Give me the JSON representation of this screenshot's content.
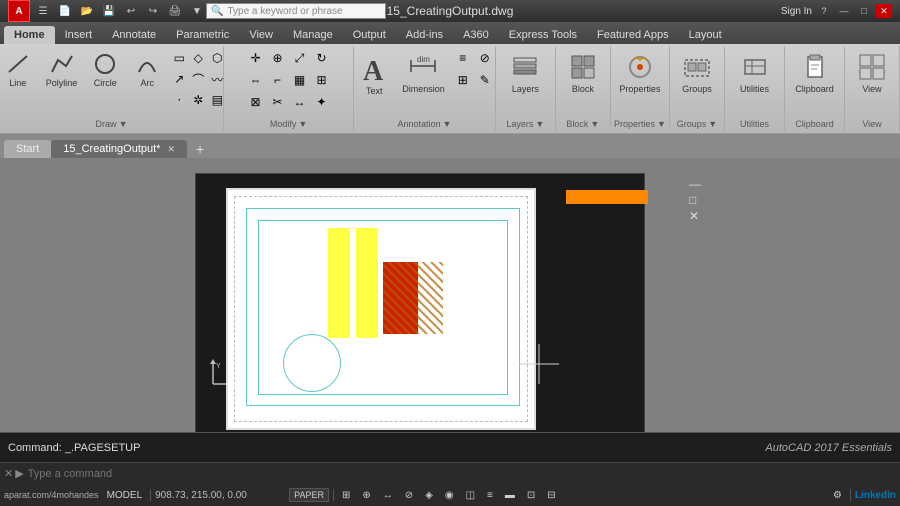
{
  "titlebar": {
    "logo": "A",
    "filename": "15_CreatingOutput.dwg",
    "search_placeholder": "Type a keyword or phrase",
    "sign_in": "Sign In",
    "minimize": "—",
    "maximize": "□",
    "close": "✕"
  },
  "quickaccess": {
    "buttons": [
      "☰",
      "📁",
      "💾",
      "↩",
      "↪",
      "▼"
    ]
  },
  "ribbon": {
    "tabs": [
      "Home",
      "Insert",
      "Annotate",
      "Parametric",
      "View",
      "Manage",
      "Output",
      "Add-ins",
      "A360",
      "Express Tools",
      "Featured Apps",
      "Layout"
    ],
    "active_tab": "Home",
    "groups": {
      "draw": {
        "label": "Draw",
        "tools": [
          "Line",
          "Polyline",
          "Circle",
          "Arc"
        ]
      },
      "modify": {
        "label": "Modify"
      },
      "annotation": {
        "label": "Annotation",
        "tools": [
          "Text",
          "Dimension"
        ]
      },
      "layers": {
        "label": "Layers",
        "tool_label": "Layers"
      },
      "block": {
        "label": "Block",
        "tool_label": "Block"
      },
      "properties": {
        "tool_label": "Properties"
      },
      "groups_tool": {
        "tool_label": "Groups"
      },
      "utilities": {
        "tool_label": "Utilities"
      },
      "clipboard": {
        "tool_label": "Clipboard"
      },
      "view": {
        "tool_label": "View"
      }
    }
  },
  "tabs": {
    "items": [
      {
        "label": "Start",
        "active": false
      },
      {
        "label": "15_CreatingOutput*",
        "active": true,
        "closeable": true
      }
    ],
    "add_label": "+"
  },
  "canvas": {
    "background_color": "#1a1a1a",
    "command_text": "Command:  _.PAGESETUP",
    "course_label": "AutoCAD 2017 Essentials"
  },
  "command": {
    "input_placeholder": "Type a command",
    "icons": [
      "✕",
      "►"
    ]
  },
  "statusbar": {
    "coordinates": "908.73, 215.00, 0.00",
    "paper_mode": "PAPER",
    "items": [
      "MODEL",
      "▦",
      "⊕",
      "↔",
      "⊘",
      "◈",
      "◉",
      "◫",
      "≡",
      "⊞",
      "⊟"
    ],
    "right_items": [
      "🔧",
      "◈",
      "Linkedin"
    ],
    "zoom_level": "",
    "aparat_label": "aparat.com/4mohandes"
  }
}
